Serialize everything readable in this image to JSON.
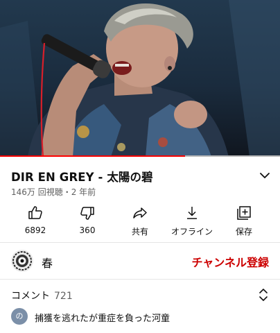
{
  "colors": {
    "accent": "#ff0000",
    "subscribe": "#cc0000",
    "muted": "#606060"
  },
  "video": {
    "description_icon": "expand-chevron-icon",
    "progress": 0.66
  },
  "title": "DIR EN GREY - 太陽の碧",
  "meta": "146万 回視聴・2 年前",
  "actions": [
    {
      "icon": "thumbs-up-icon",
      "label": "6892"
    },
    {
      "icon": "thumbs-down-icon",
      "label": "360"
    },
    {
      "icon": "share-icon",
      "label": "共有"
    },
    {
      "icon": "download-icon",
      "label": "オフライン"
    },
    {
      "icon": "save-playlist-icon",
      "label": "保存"
    }
  ],
  "channel": {
    "name": "春",
    "subscribe_label": "チャンネル登録"
  },
  "comments": {
    "label": "コメント",
    "count": "721",
    "avatar_letter": "の",
    "top_comment": "捕獲を逃れたが重症を負った河童"
  }
}
